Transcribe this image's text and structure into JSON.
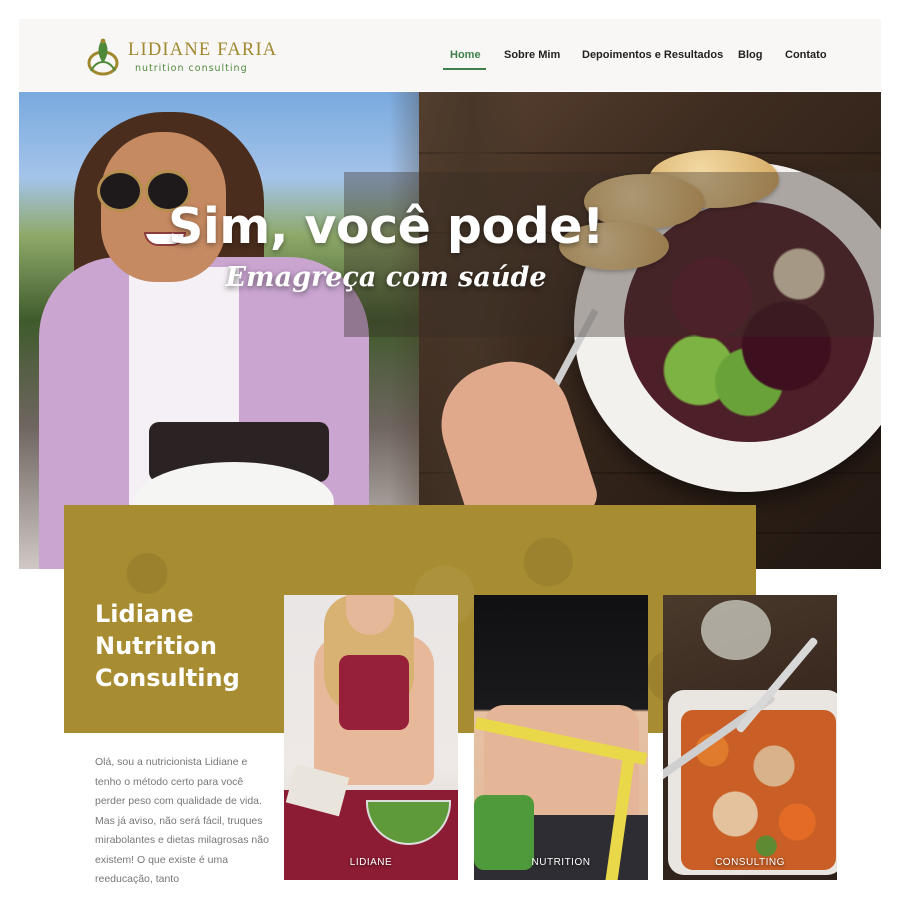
{
  "header": {
    "logo": {
      "name": "LIDIANE FARIA",
      "tagline": "nutrition consulting"
    },
    "nav": [
      {
        "label": "Home",
        "active": true
      },
      {
        "label": "Sobre Mim",
        "active": false
      },
      {
        "label": "Depoimentos e Resultados",
        "active": false
      },
      {
        "label": "Blog",
        "active": false
      },
      {
        "label": "Contato",
        "active": false
      }
    ]
  },
  "hero": {
    "title": "Sim, você pode!",
    "subtitle": "Emagreça com saúde"
  },
  "about": {
    "title_lines": [
      "Lidiane",
      "Nutrition",
      "Consulting"
    ],
    "intro": "Olá, sou a nutricionista Lidiane e tenho o método certo para você perder peso com qualidade de vida. Mas já aviso, não será fácil, truques mirabolantes e dietas milagrosas não existem! O que existe é uma reeducação, tanto"
  },
  "cards": [
    {
      "label": "LIDIANE"
    },
    {
      "label": "NUTRITION"
    },
    {
      "label": "CONSULTING"
    }
  ],
  "colors": {
    "gold": "#a88c31",
    "green_accent": "#3f8048",
    "logo_gold": "#a0882f",
    "text_gray": "#777777"
  }
}
